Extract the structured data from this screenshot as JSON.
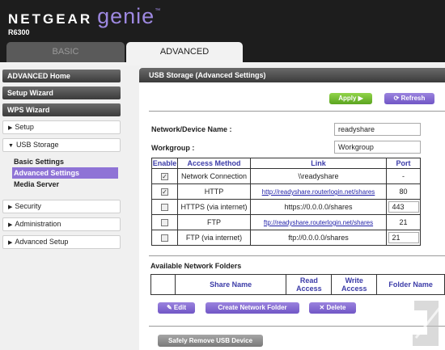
{
  "brand": {
    "name": "NETGEAR",
    "product": "genie",
    "trademark": "™",
    "model": "R6300"
  },
  "tabs": {
    "basic": "BASIC",
    "advanced": "ADVANCED"
  },
  "sidebar": {
    "advanced_home": "ADVANCED Home",
    "setup_wizard": "Setup Wizard",
    "wps_wizard": "WPS Wizard",
    "setup": "Setup",
    "usb_storage": "USB Storage",
    "usb_sub": [
      "Basic Settings",
      "Advanced Settings",
      "Media Server"
    ],
    "security": "Security",
    "administration": "Administration",
    "advanced_setup": "Advanced Setup"
  },
  "main": {
    "title": "USB Storage (Advanced Settings)",
    "apply_label": "Apply ▶",
    "refresh_label": "Refresh",
    "device_name_label": "Network/Device Name :",
    "device_name_value": "readyshare",
    "workgroup_label": "Workgroup :",
    "workgroup_value": "Workgroup",
    "access_headers": [
      "Enable",
      "Access Method",
      "Link",
      "Port"
    ],
    "access_rows": [
      {
        "enabled": true,
        "method": "Network Connection",
        "link": "\\\\readyshare",
        "port": "-"
      },
      {
        "enabled": true,
        "method": "HTTP",
        "link": "http://readyshare.routerlogin.net/shares",
        "port": "80"
      },
      {
        "enabled": false,
        "method": "HTTPS (via internet)",
        "link": "https://0.0.0.0/shares",
        "port": "443"
      },
      {
        "enabled": false,
        "method": "FTP",
        "link": "ftp://readyshare.routerlogin.net/shares",
        "port": "21"
      },
      {
        "enabled": false,
        "method": "FTP (via internet)",
        "link": "ftp://0.0.0.0/shares",
        "port": "21"
      }
    ],
    "folders_title": "Available Network Folders",
    "folder_headers": [
      "",
      "Share Name",
      "Read Access",
      "Write Access",
      "Folder Name"
    ],
    "edit_label": "Edit",
    "create_label": "Create Network Folder",
    "delete_label": "Delete",
    "remove_label": "Safely Remove USB Device"
  },
  "colors": {
    "accent": "#8f73d6",
    "apply_green": "#6cb52c",
    "header_bg": "#1d1d1d"
  }
}
